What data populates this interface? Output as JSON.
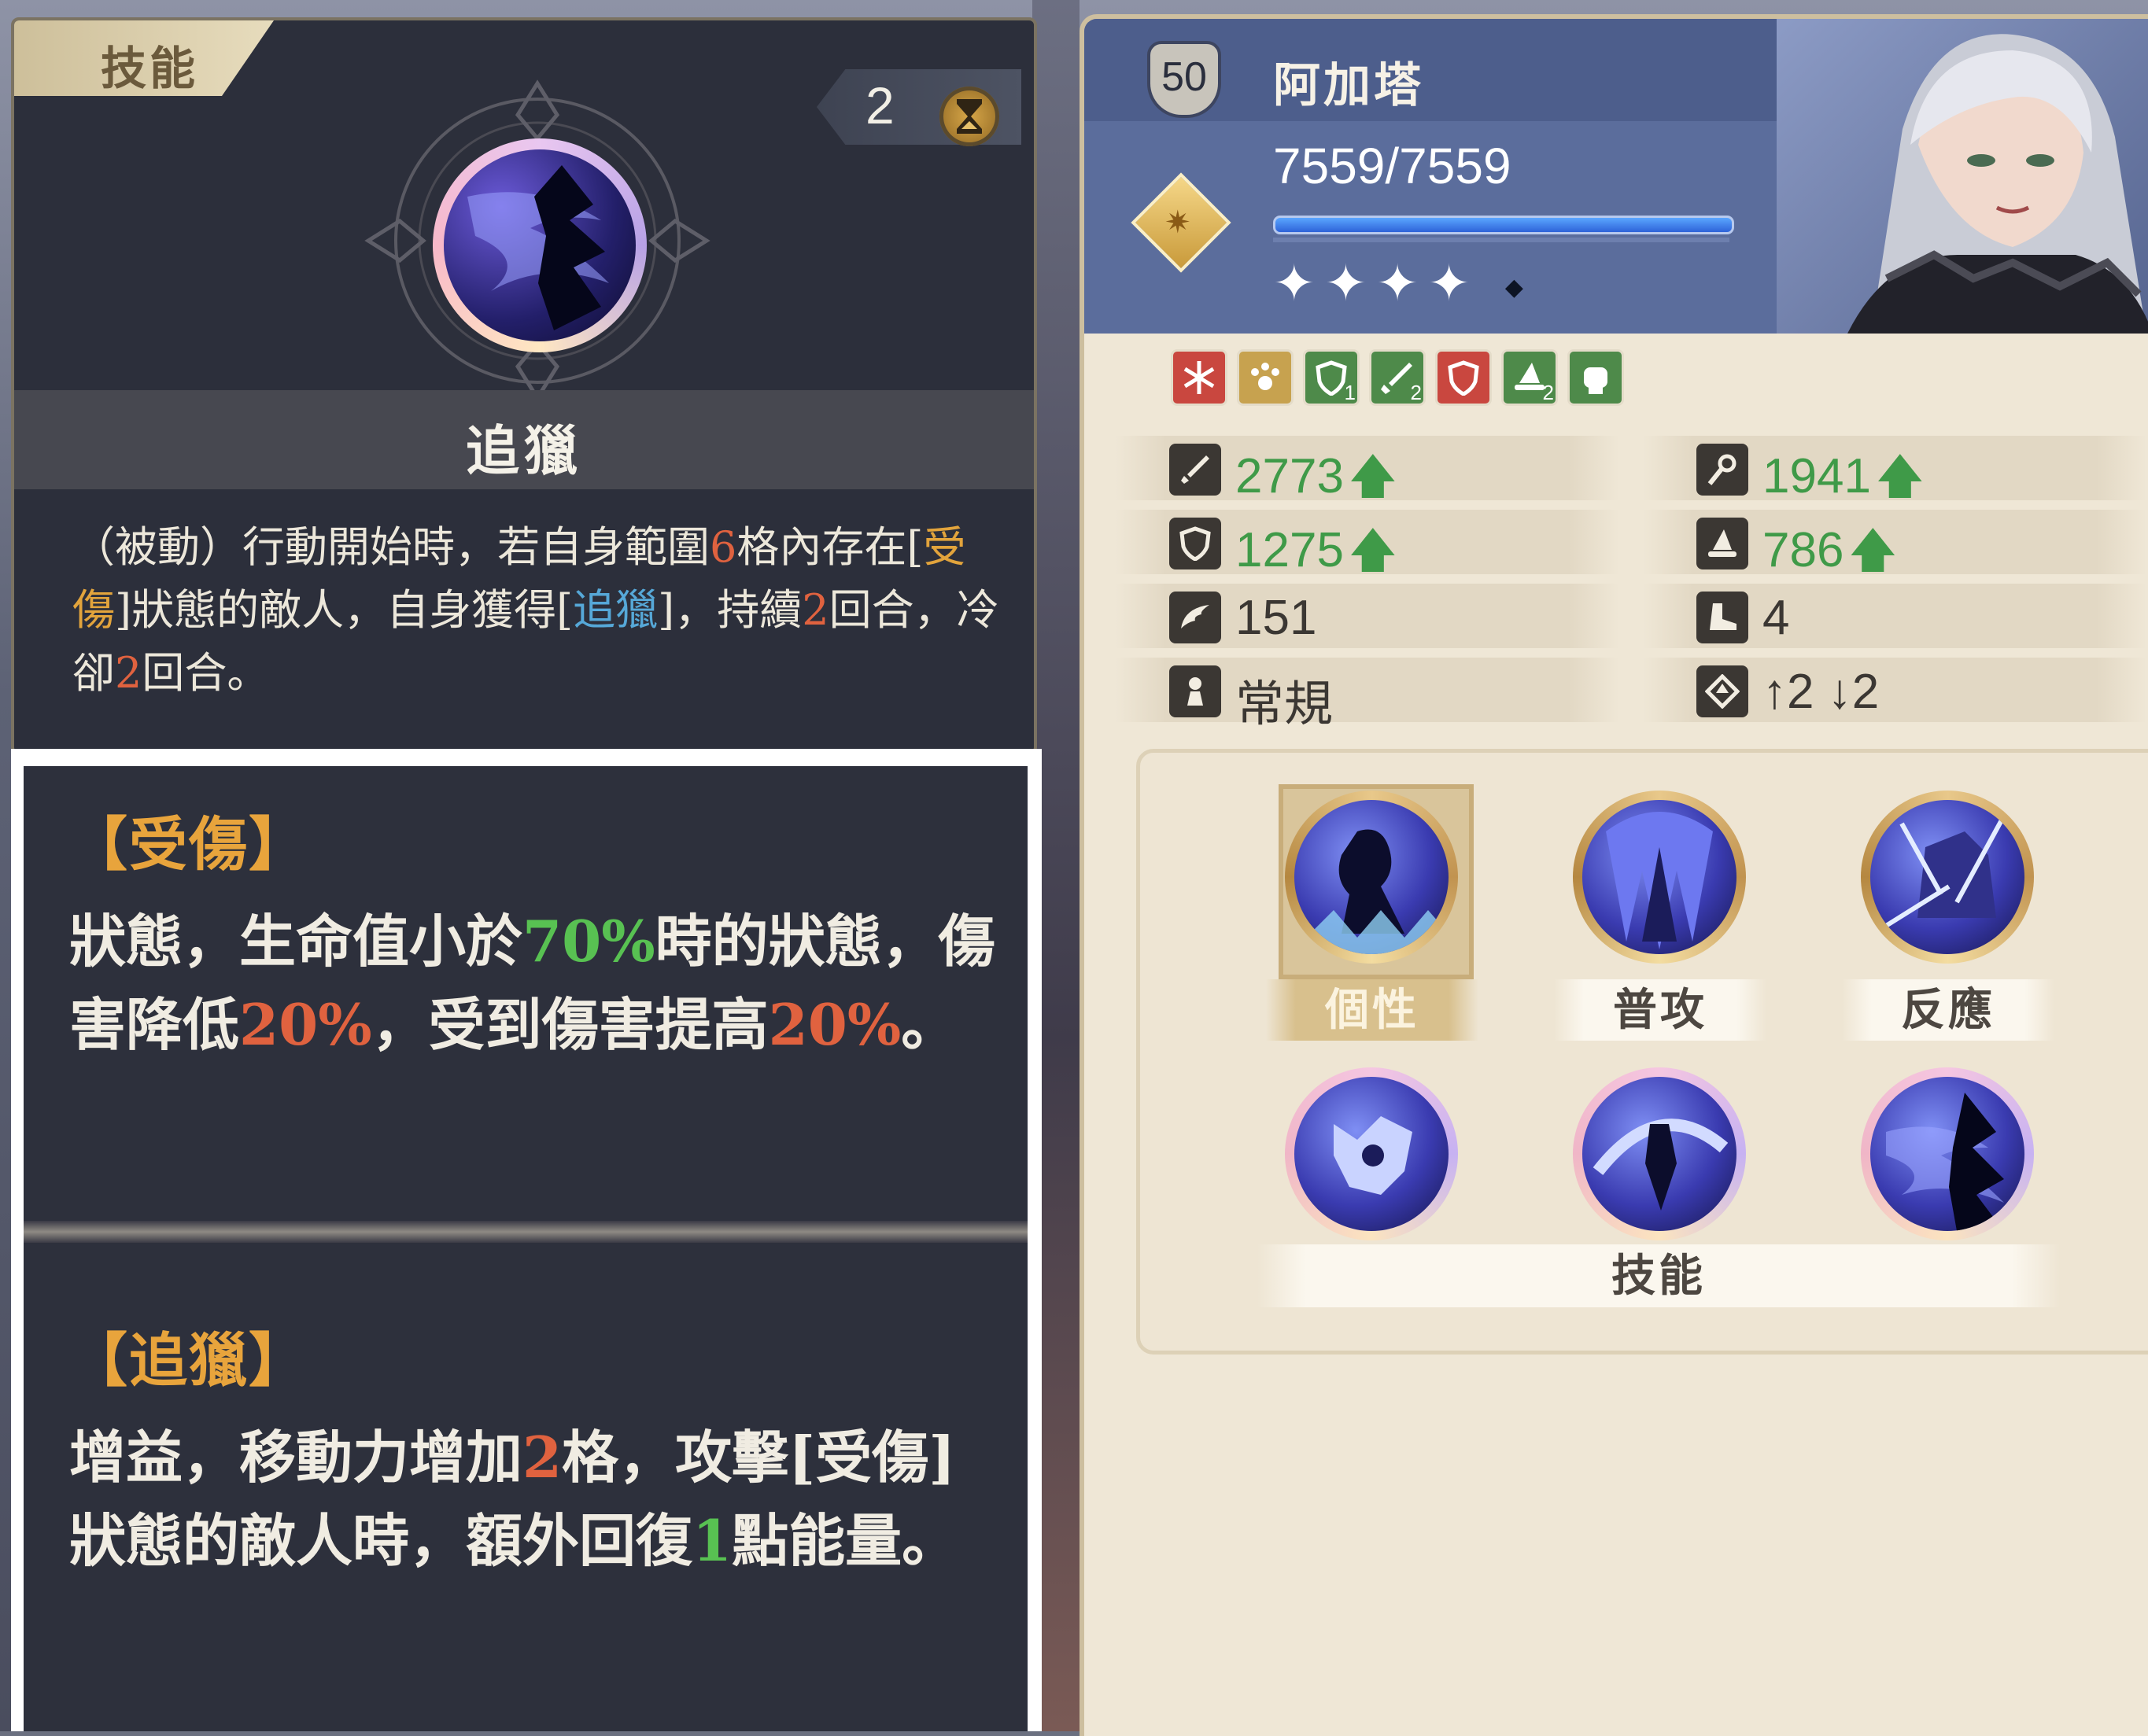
{
  "skill_panel": {
    "tab_label": "技能",
    "cooldown": "2",
    "skill_name": "追獵",
    "description": [
      {
        "t": "（被動）行動開始時，若自身範圍",
        "c": ""
      },
      {
        "t": "6",
        "c": "red"
      },
      {
        "t": "格內存在[",
        "c": ""
      },
      {
        "t": "受傷",
        "c": "yellow"
      },
      {
        "t": "]狀態的敵人，自身獲得[",
        "c": ""
      },
      {
        "t": "追獵",
        "c": "blue"
      },
      {
        "t": "]，持續",
        "c": ""
      },
      {
        "t": "2",
        "c": "red"
      },
      {
        "t": "回合，冷卻",
        "c": ""
      },
      {
        "t": "2",
        "c": "red"
      },
      {
        "t": "回合。",
        "c": ""
      }
    ]
  },
  "tooltips": [
    {
      "title": "【受傷】",
      "body": [
        {
          "t": "狀態，生命值小於",
          "c": ""
        },
        {
          "t": "70%",
          "c": "green"
        },
        {
          "t": "時的狀態，傷害降低",
          "c": ""
        },
        {
          "t": "20%",
          "c": "red"
        },
        {
          "t": "，受到傷害提高",
          "c": ""
        },
        {
          "t": "20%",
          "c": "red"
        },
        {
          "t": "。",
          "c": ""
        }
      ]
    },
    {
      "title": "【追獵】",
      "body": [
        {
          "t": "增益，移動力增加",
          "c": ""
        },
        {
          "t": "2",
          "c": "red"
        },
        {
          "t": "格，攻擊[受傷]狀態的敵人時，額外回復",
          "c": ""
        },
        {
          "t": "1",
          "c": "green"
        },
        {
          "t": "點能量。",
          "c": ""
        }
      ]
    }
  ],
  "character": {
    "level": "50",
    "name": "阿加塔",
    "hp_text": "7559/7559",
    "hp_fraction": 1.0,
    "star_count": 4,
    "buffs": [
      {
        "icon": "snowflake-icon",
        "color": "#c9473f",
        "sub": ""
      },
      {
        "icon": "paw-icon",
        "color": "#c7a24f",
        "sub": ""
      },
      {
        "icon": "shield-up-icon",
        "color": "#4e8a4a",
        "sub": "1"
      },
      {
        "icon": "sword-up-icon",
        "color": "#4e8a4a",
        "sub": "2"
      },
      {
        "icon": "shield-down-icon",
        "color": "#c9473f",
        "sub": ""
      },
      {
        "icon": "hat-up-icon",
        "color": "#4e8a4a",
        "sub": "2"
      },
      {
        "icon": "fist-icon",
        "color": "#4e8a4a",
        "sub": ""
      }
    ]
  },
  "stats": {
    "attack": "2773",
    "magic_attack": "1941",
    "defense": "1275",
    "magic_defense": "786",
    "skill_stat": "151",
    "movement": "4",
    "move_type": "常規",
    "elevation": "↑2 ↓2"
  },
  "skills": {
    "labels": {
      "trait": "個性",
      "normal": "普攻",
      "reaction": "反應",
      "skills": "技能"
    }
  },
  "colors": {
    "accent_red": "#e0623f",
    "accent_yellow": "#e2a43c",
    "accent_blue": "#56a8d8",
    "accent_green": "#58c152",
    "stat_green": "#3f9a48"
  }
}
